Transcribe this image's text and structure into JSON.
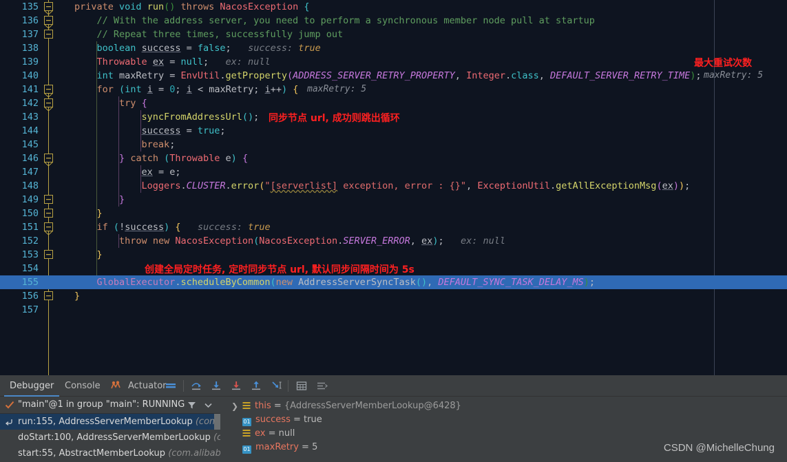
{
  "editor": {
    "first_line": 135,
    "highlighted_line": 155,
    "margin_guide_x": 1037,
    "lines": [
      {
        "n": 135,
        "fold": "collapse-top",
        "indent": 0
      },
      {
        "n": 136,
        "fold": "collapse-mid",
        "indent": 0
      },
      {
        "n": 137,
        "fold": "collapse-end",
        "indent": 0
      },
      {
        "n": 138,
        "fold": "none",
        "indent": 1
      },
      {
        "n": 139,
        "fold": "none",
        "indent": 1
      },
      {
        "n": 140,
        "fold": "none",
        "indent": 1
      },
      {
        "n": 141,
        "fold": "collapse-top",
        "indent": 1
      },
      {
        "n": 142,
        "fold": "collapse-top",
        "indent": 2
      },
      {
        "n": 143,
        "fold": "none",
        "indent": 3
      },
      {
        "n": 144,
        "fold": "none",
        "indent": 3
      },
      {
        "n": 145,
        "fold": "none",
        "indent": 3
      },
      {
        "n": 146,
        "fold": "collapse-top",
        "indent": 2
      },
      {
        "n": 147,
        "fold": "none",
        "indent": 3
      },
      {
        "n": 148,
        "fold": "none",
        "indent": 3
      },
      {
        "n": 149,
        "fold": "collapse-end",
        "indent": 2
      },
      {
        "n": 150,
        "fold": "collapse-end",
        "indent": 1
      },
      {
        "n": 151,
        "fold": "collapse-top",
        "indent": 1
      },
      {
        "n": 152,
        "fold": "none",
        "indent": 2
      },
      {
        "n": 153,
        "fold": "collapse-end",
        "indent": 1
      },
      {
        "n": 154,
        "fold": "none",
        "indent": 1
      },
      {
        "n": 155,
        "fold": "none",
        "indent": 1
      },
      {
        "n": 156,
        "fold": "collapse-end",
        "indent": 0
      },
      {
        "n": 157,
        "fold": "none",
        "indent": 0
      }
    ],
    "code_text": {
      "l135": "private void run() throws NacosException {",
      "l136": "// With the address server, you need to perform a synchronous member node pull at startup",
      "l137": "// Repeat three times, successfully jump out",
      "l138": "boolean success = false;",
      "l138_hint": "success: true",
      "l139": "Throwable ex = null;",
      "l139_hint": "ex: null",
      "l140": "int maxRetry = EnvUtil.getProperty(ADDRESS_SERVER_RETRY_PROPERTY, Integer.class, DEFAULT_SERVER_RETRY_TIME);",
      "l140_hint": "maxRetry: 5",
      "l141": "for (int i = 0; i < maxRetry; i++) {",
      "l141_hint": "maxRetry: 5",
      "l142": "try {",
      "l143": "syncFromAddressUrl();",
      "l144": "success = true;",
      "l145": "break;",
      "l146": "} catch (Throwable e) {",
      "l147": "ex = e;",
      "l148": "Loggers.CLUSTER.error(\"[serverlist] exception, error : {}\", ExceptionUtil.getAllExceptionMsg(ex));",
      "l149": "}",
      "l150": "}",
      "l151": "if (!success) {",
      "l151_hint": "success: true",
      "l152": "throw new NacosException(NacosException.SERVER_ERROR, ex);",
      "l152_hint": "ex: null",
      "l153": "}",
      "l155": "GlobalExecutor.scheduleByCommon(new AddressServerSyncTask(), DEFAULT_SYNC_TASK_DELAY_MS);",
      "l156": "}"
    },
    "annotations": {
      "max_retry": "最大重试次数",
      "sync_node": "同步节点 url, 成功则跳出循环",
      "global_task": "创建全局定时任务, 定时同步节点 url, 默认同步间隔时间为 5s"
    }
  },
  "panel": {
    "tabs": [
      {
        "label": "Debugger",
        "active": true
      },
      {
        "label": "Console",
        "active": false
      },
      {
        "label": "Actuator",
        "active": false,
        "icon": "actuator-icon"
      }
    ],
    "toolbar_icons": [
      "show-execution-point-icon",
      "step-over-icon",
      "step-into-icon",
      "force-step-into-icon",
      "step-out-icon",
      "run-to-cursor-icon",
      "evaluate-expression-icon",
      "layout-settings-icon"
    ],
    "thread": {
      "status_icon": "check-icon",
      "label": "\"main\"@1 in group \"main\": RUNNING",
      "filter_icon": "filter-icon",
      "dropdown_icon": "chevron-down-icon"
    },
    "frames": [
      {
        "icon": "return-arrow-icon",
        "method": "run:155, AddressServerMemberLookup",
        "pkg": "(com.ali",
        "selected": true
      },
      {
        "icon": "",
        "method": "doStart:100, AddressServerMemberLookup",
        "pkg": "(cor",
        "selected": false
      },
      {
        "icon": "",
        "method": "start:55, AbstractMemberLookup",
        "pkg": "(com.alibaba.r",
        "selected": false
      }
    ],
    "variables": [
      {
        "icon": "object-icon",
        "expander": ">",
        "name": "this",
        "op": "=",
        "value": "{AddressServerMemberLookup@6428}",
        "value_kind": "object"
      },
      {
        "icon": "primitive-icon",
        "expander": "",
        "name": "success",
        "op": "=",
        "value": "true",
        "value_kind": "keyword"
      },
      {
        "icon": "object-icon",
        "expander": "",
        "name": "ex",
        "op": "=",
        "value": "null",
        "value_kind": "keyword"
      },
      {
        "icon": "primitive-icon",
        "expander": "",
        "name": "maxRetry",
        "op": "=",
        "value": "5",
        "value_kind": "keyword"
      }
    ],
    "primitive_badge": "01",
    "watermark": "CSDN @MichelleChung"
  },
  "colors": {
    "editor_bg": "#0e1420",
    "panel_bg": "#3c3f41",
    "selection": "#2f6ab5",
    "linenumber": "#55b4d4",
    "annotation_red": "#ff2020",
    "fold_rail": "#b9a243",
    "accent_blue": "#4a88c7"
  }
}
